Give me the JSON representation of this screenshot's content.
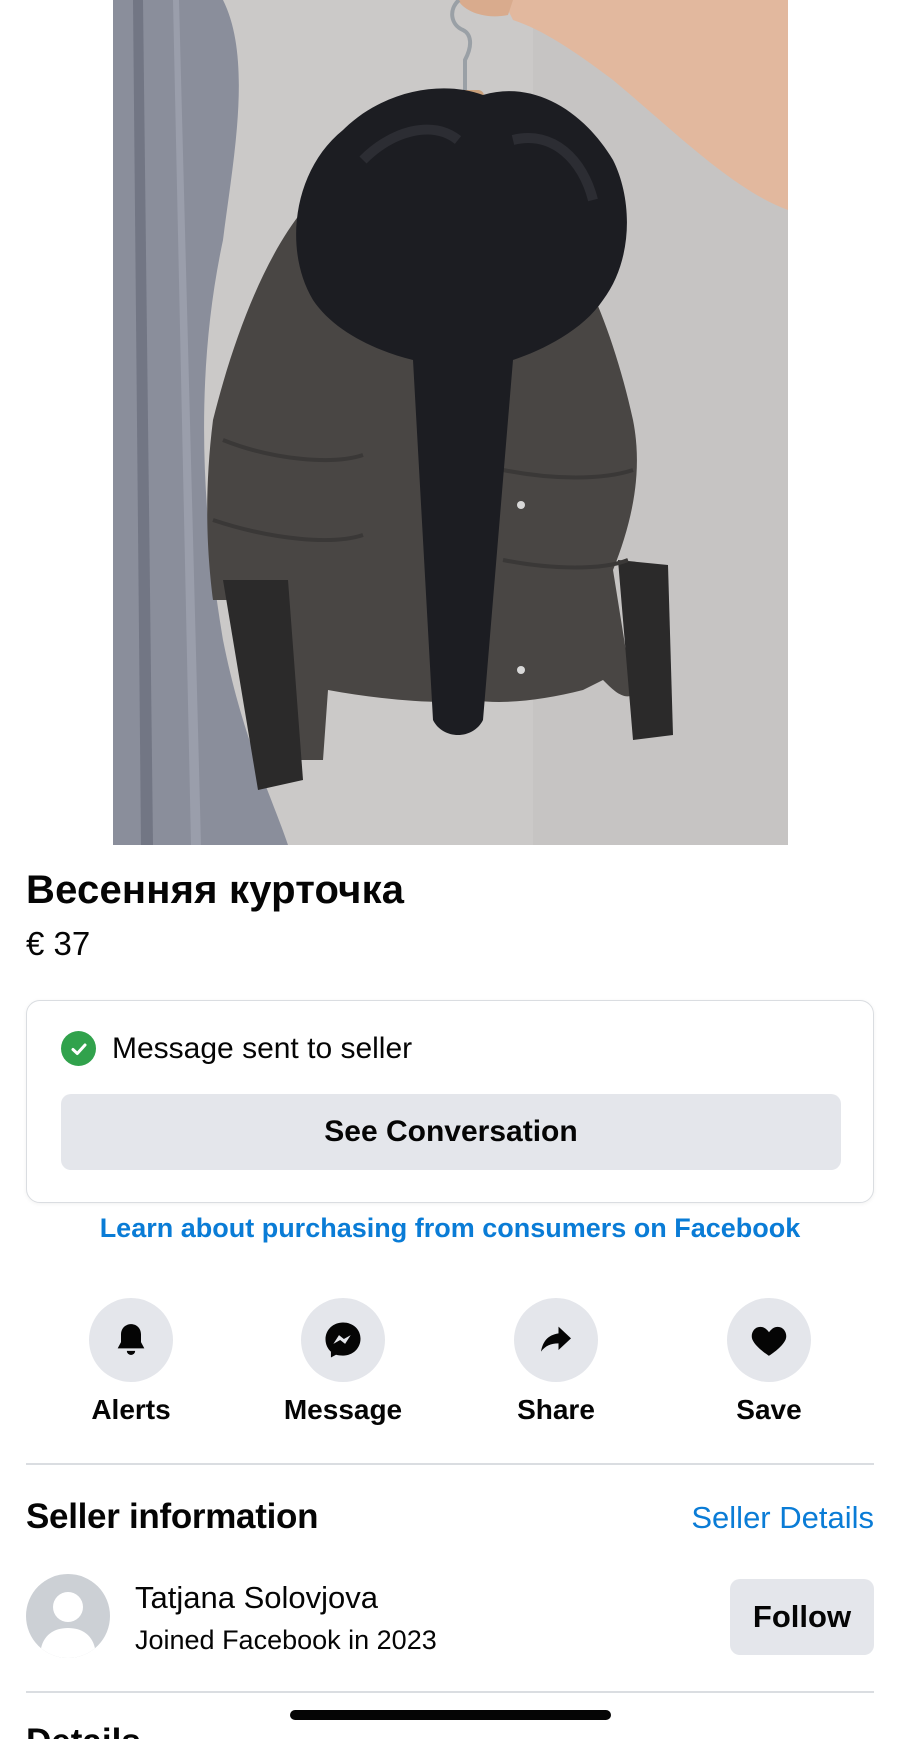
{
  "listing": {
    "title": "Весенняя курточка",
    "price": "€ 37"
  },
  "message_card": {
    "status_text": "Message sent to seller",
    "status_icon": "checkmark-circle-icon",
    "status_color": "#31a24c",
    "button_label": "See Conversation"
  },
  "learn_link": "Learn about purchasing from consumers on Facebook",
  "actions": [
    {
      "label": "Alerts",
      "icon": "bell-icon"
    },
    {
      "label": "Message",
      "icon": "messenger-icon"
    },
    {
      "label": "Share",
      "icon": "share-arrow-icon"
    },
    {
      "label": "Save",
      "icon": "heart-icon"
    }
  ],
  "seller": {
    "heading": "Seller information",
    "details_link": "Seller Details",
    "name": "Tatjana Solovjova",
    "joined": "Joined Facebook in 2023",
    "follow_label": "Follow"
  },
  "next_section": {
    "heading": "Details"
  },
  "colors": {
    "link": "#0a7cd6",
    "button_bg": "#e4e6eb",
    "text": "#050505"
  }
}
